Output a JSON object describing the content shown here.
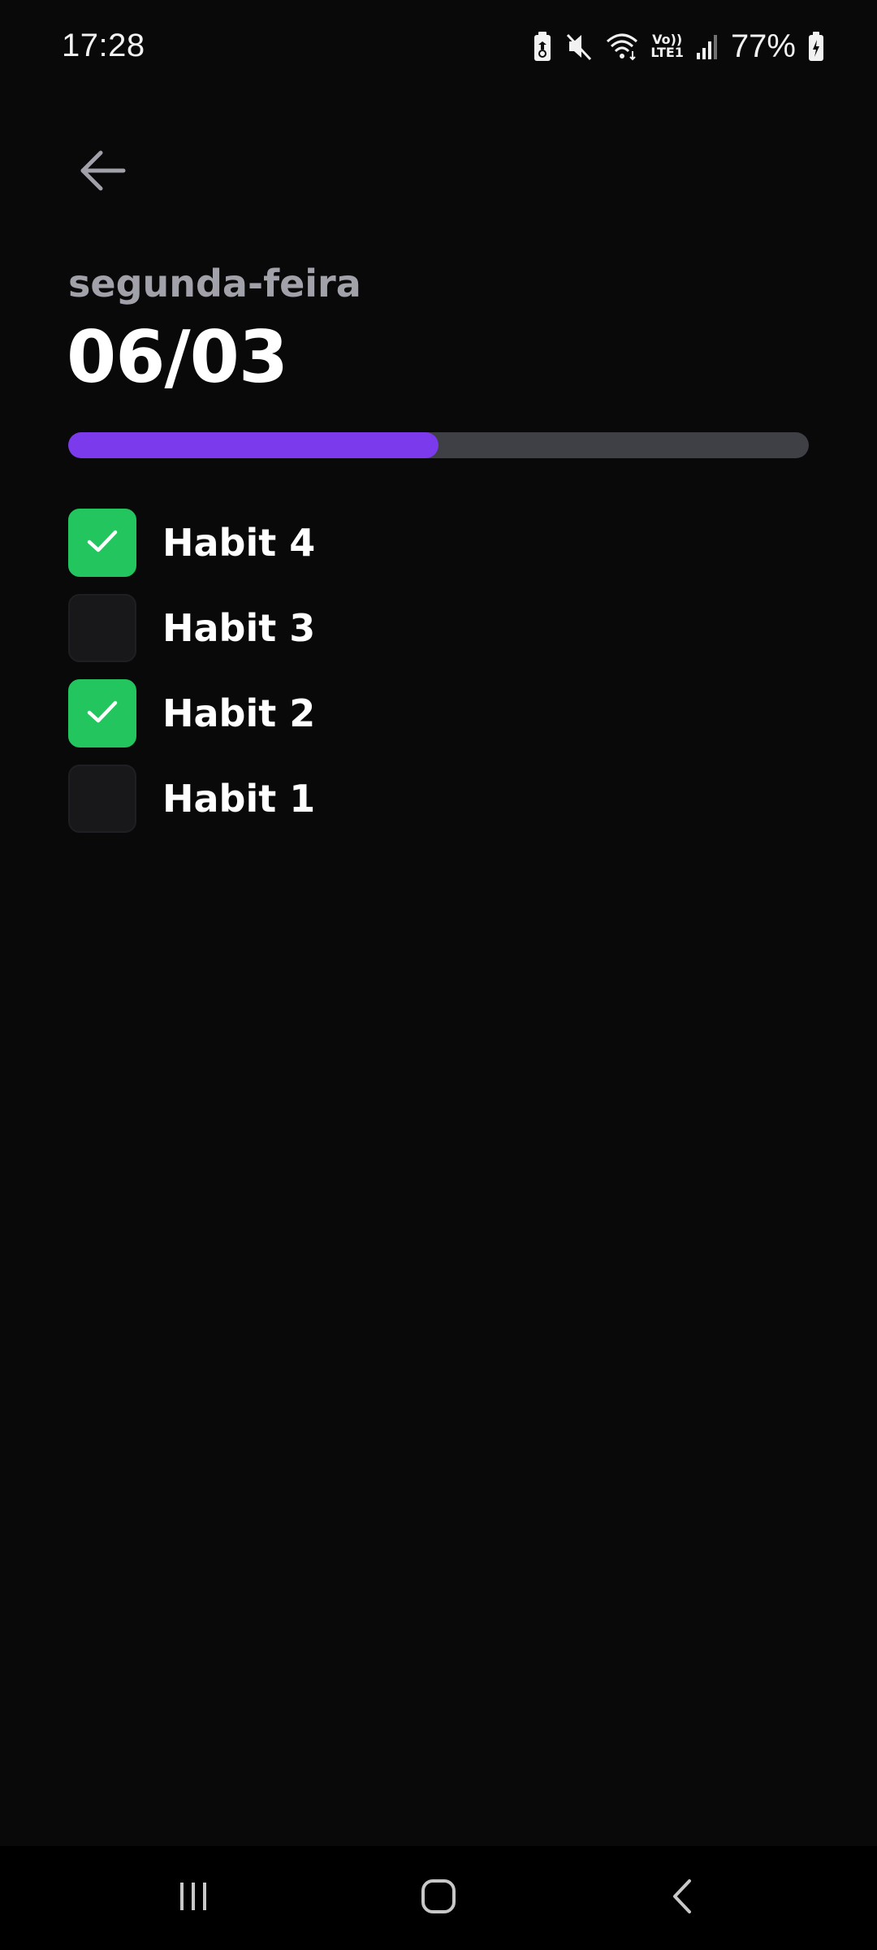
{
  "status_bar": {
    "time": "17:28",
    "battery_percent": "77%",
    "network_label_top": "Vo))",
    "network_label_bottom": "LTE1",
    "icons": [
      "battery-saver-icon",
      "mute-icon",
      "wifi-icon",
      "volte-icon",
      "signal-icon",
      "battery-charging-icon"
    ]
  },
  "header": {
    "back_icon": "arrow-left-icon",
    "weekday": "segunda-feira",
    "date": "06/03"
  },
  "progress": {
    "completed": 2,
    "total": 4,
    "fraction": 0.5
  },
  "habits": [
    {
      "label": "Habit 4",
      "checked": true
    },
    {
      "label": "Habit 3",
      "checked": false
    },
    {
      "label": "Habit 2",
      "checked": true
    },
    {
      "label": "Habit 1",
      "checked": false
    }
  ],
  "nav_bar": {
    "icons": [
      "recent-apps-icon",
      "home-icon",
      "back-icon"
    ]
  },
  "colors": {
    "background": "#09090a",
    "accent": "#7c3aed",
    "success": "#22c55e",
    "track": "#3f3f46",
    "muted_text": "#a1a1aa",
    "checkbox_empty": "#18181b"
  }
}
